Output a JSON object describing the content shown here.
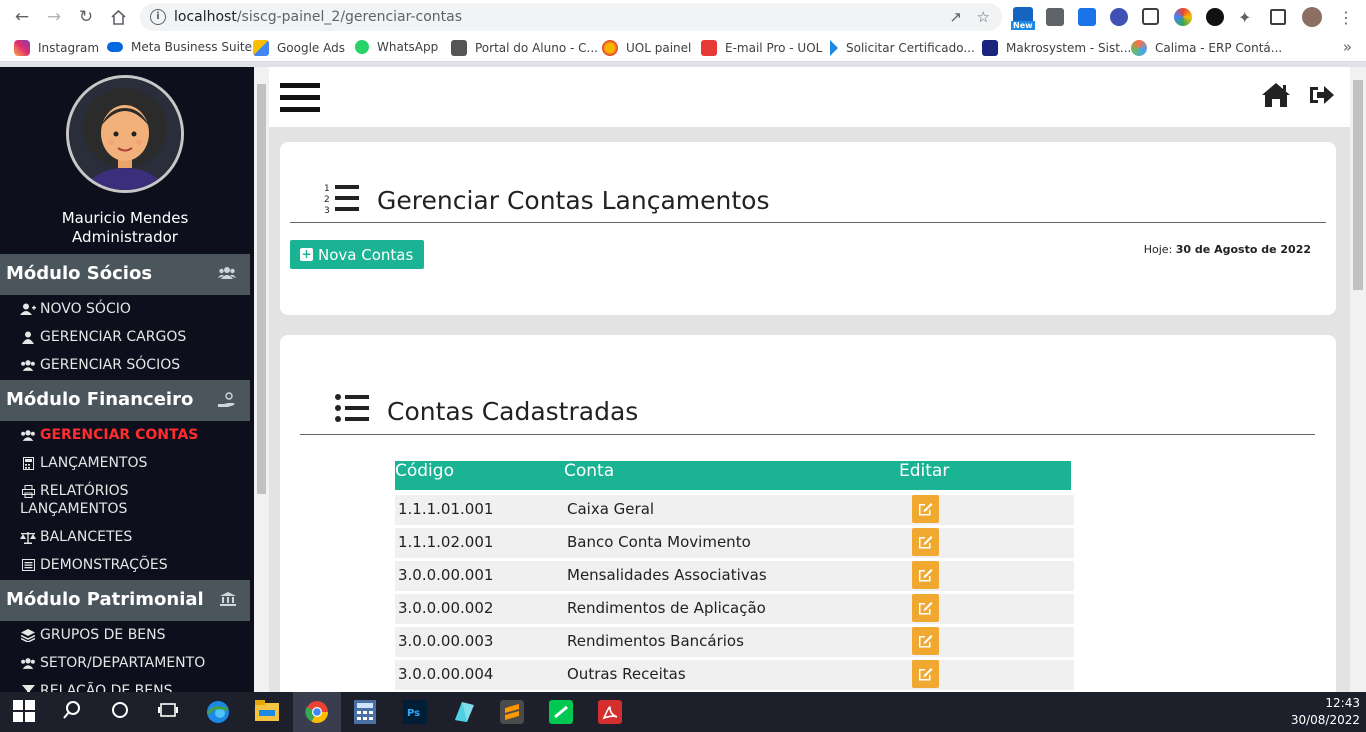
{
  "browser": {
    "url_host": "localhost",
    "url_path": "/siscg-painel_2/gerenciar-contas",
    "bookmarks": [
      {
        "label": "Instagram",
        "icon": "instagram-icon",
        "color": "#e1306c"
      },
      {
        "label": "Meta Business Suite",
        "icon": "meta-icon",
        "color": "#0668e1"
      },
      {
        "label": "Google Ads",
        "icon": "google-ads-icon",
        "color": "#fbbc04"
      },
      {
        "label": "WhatsApp",
        "icon": "whatsapp-icon",
        "color": "#25d366"
      },
      {
        "label": "Portal do Aluno - C...",
        "icon": "portal-icon",
        "color": "#555555"
      },
      {
        "label": "UOL painel",
        "icon": "uol-icon",
        "color": "#f7b500"
      },
      {
        "label": "E-mail Pro - UOL",
        "icon": "email-uol-icon",
        "color": "#e53935"
      },
      {
        "label": "Solicitar Certificado...",
        "icon": "certificado-icon",
        "color": "#1e88e5"
      },
      {
        "label": "Makrosystem - Sist...",
        "icon": "makrosystem-icon",
        "color": "#1a237e"
      },
      {
        "label": "Calima - ERP Contá...",
        "icon": "calima-icon",
        "color": "#ff7043"
      }
    ],
    "new_badge": "New"
  },
  "sidebar": {
    "user_name": "Mauricio Mendes",
    "user_role": "Administrador",
    "modules": [
      {
        "title": "Módulo Sócios",
        "icon": "users-icon",
        "items": [
          {
            "label": "NOVO SÓCIO",
            "icon": "user-plus-icon"
          },
          {
            "label": "GERENCIAR CARGOS",
            "icon": "user-icon"
          },
          {
            "label": "GERENCIAR SÓCIOS",
            "icon": "users-icon"
          }
        ]
      },
      {
        "title": "Módulo Financeiro",
        "icon": "hand-coin-icon",
        "items": [
          {
            "label": "GERENCIAR CONTAS",
            "icon": "users-icon",
            "active": true
          },
          {
            "label": "LANÇAMENTOS",
            "icon": "calculator-icon"
          },
          {
            "label": "RELATÓRIOS",
            "label2": "LANÇAMENTOS",
            "icon": "print-icon"
          },
          {
            "label": "BALANCETES",
            "icon": "balance-scale-icon"
          },
          {
            "label": "DEMONSTRAÇÕES",
            "icon": "list-alt-icon"
          }
        ]
      },
      {
        "title": "Módulo Patrimonial",
        "icon": "bank-icon",
        "items": [
          {
            "label": "GRUPOS DE BENS",
            "icon": "layers-icon"
          },
          {
            "label": "SETOR/DEPARTAMENTO",
            "icon": "users-icon"
          },
          {
            "label": "RELAÇÃO DE BENS",
            "icon": "filter-icon"
          }
        ]
      }
    ]
  },
  "header_card": {
    "title": "Gerenciar Contas Lançamentos",
    "button_label": "Nova Contas",
    "today_label": "Hoje:",
    "today_value": "30 de Agosto de 2022"
  },
  "list_card": {
    "title": "Contas Cadastradas",
    "columns": [
      "Código",
      "Conta",
      "Editar"
    ],
    "rows": [
      {
        "codigo": "1.1.1.01.001",
        "conta": "Caixa Geral"
      },
      {
        "codigo": "1.1.1.02.001",
        "conta": "Banco Conta Movimento"
      },
      {
        "codigo": "3.0.0.00.001",
        "conta": "Mensalidades Associativas"
      },
      {
        "codigo": "3.0.0.00.002",
        "conta": "Rendimentos de Aplicação"
      },
      {
        "codigo": "3.0.0.00.003",
        "conta": "Rendimentos Bancários"
      },
      {
        "codigo": "3.0.0.00.004",
        "conta": "Outras Receitas"
      }
    ]
  },
  "taskbar": {
    "time": "12:43",
    "date": "30/08/2022"
  },
  "colors": {
    "accent": "#1ab394",
    "edit": "#f0a830",
    "active_menu": "#ff2d2d",
    "sidebar_bg": "#0d0f1c",
    "module_header": "#4b555c"
  }
}
